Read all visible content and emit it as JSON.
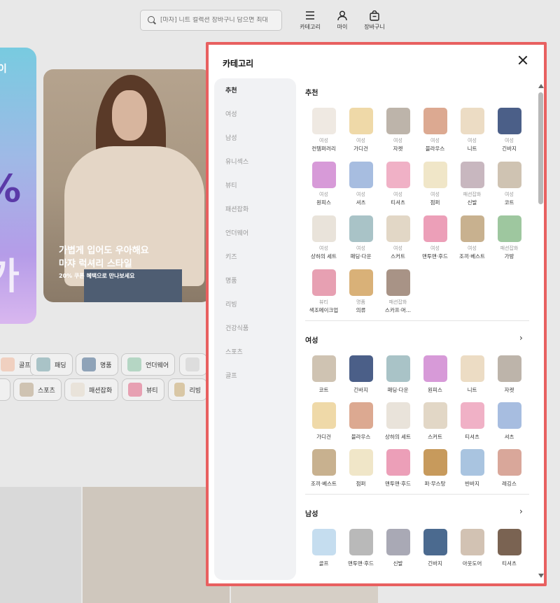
{
  "header": {
    "search_placeholder": "[마자] 니트 컬렉션 장바구니 담으면 최대",
    "nav": [
      {
        "label": "카테고리",
        "icon": "menu-icon"
      },
      {
        "label": "마이",
        "icon": "person-icon"
      },
      {
        "label": "장바구니",
        "icon": "bag-icon"
      }
    ]
  },
  "banner": {
    "left_text": "데이",
    "left_big": "%",
    "left_big2": "가",
    "main_line1": "가볍게 입어도 우아해요",
    "main_line2": "마쟈 럭셔리 스타일",
    "main_sub": "20% 쿠폰 혜택으로 만나보세요"
  },
  "chips": [
    "골프",
    "패딩",
    "명품",
    "언더웨어",
    "스포츠",
    "패션잡화",
    "뷰티",
    "리빙"
  ],
  "panel": {
    "title": "카테고리",
    "sidebar": [
      "추천",
      "여성",
      "남성",
      "유니섹스",
      "뷰티",
      "패션잡화",
      "언더웨어",
      "키즈",
      "명품",
      "리빙",
      "건강식품",
      "스포츠",
      "골프"
    ],
    "sections": [
      {
        "title": "추천",
        "items": [
          {
            "sub": "여성",
            "name": "컨템퍼러리",
            "color": "#efe9e2"
          },
          {
            "sub": "여성",
            "name": "가디건",
            "color": "#efd9a8"
          },
          {
            "sub": "여성",
            "name": "자켓",
            "color": "#bdb4aa"
          },
          {
            "sub": "여성",
            "name": "블라우스",
            "color": "#dca991"
          },
          {
            "sub": "여성",
            "name": "니트",
            "color": "#ecdcc4"
          },
          {
            "sub": "여성",
            "name": "긴바지",
            "color": "#4b5f88"
          },
          {
            "sub": "여성",
            "name": "원피스",
            "color": "#d79ad8"
          },
          {
            "sub": "여성",
            "name": "셔츠",
            "color": "#a7bde0"
          },
          {
            "sub": "여성",
            "name": "티셔츠",
            "color": "#f0b1c6"
          },
          {
            "sub": "여성",
            "name": "점퍼",
            "color": "#f0e6c8"
          },
          {
            "sub": "패션잡화",
            "name": "신발",
            "color": "#c8b7bf"
          },
          {
            "sub": "여성",
            "name": "코트",
            "color": "#cfc3b2"
          },
          {
            "sub": "여성",
            "name": "상하의 세트",
            "color": "#e9e3da"
          },
          {
            "sub": "여성",
            "name": "패딩·다운",
            "color": "#a9c3c7"
          },
          {
            "sub": "여성",
            "name": "스커트",
            "color": "#e2d7c6"
          },
          {
            "sub": "여성",
            "name": "맨투맨·후드",
            "color": "#ec9fb8"
          },
          {
            "sub": "여성",
            "name": "조끼·베스트",
            "color": "#c8b18f"
          },
          {
            "sub": "패션잡화",
            "name": "가방",
            "color": "#9ec79f"
          },
          {
            "sub": "뷰티",
            "name": "색조메이크업",
            "color": "#e7a0b2"
          },
          {
            "sub": "명품",
            "name": "의류",
            "color": "#d9b178"
          },
          {
            "sub": "패션잡화",
            "name": "스카프·머...",
            "color": "#a89386"
          }
        ]
      },
      {
        "title": "여성",
        "items": [
          {
            "name": "코트",
            "color": "#cfc3b2"
          },
          {
            "name": "긴바지",
            "color": "#4b5f88"
          },
          {
            "name": "패딩·다운",
            "color": "#a9c3c7"
          },
          {
            "name": "원피스",
            "color": "#d79ad8"
          },
          {
            "name": "니트",
            "color": "#ecdcc4"
          },
          {
            "name": "자켓",
            "color": "#bdb4aa"
          },
          {
            "name": "가디건",
            "color": "#efd9a8"
          },
          {
            "name": "블라우스",
            "color": "#dca991"
          },
          {
            "name": "상하의 세트",
            "color": "#e9e3da"
          },
          {
            "name": "스커트",
            "color": "#e2d7c6"
          },
          {
            "name": "티셔츠",
            "color": "#f0b1c6"
          },
          {
            "name": "셔츠",
            "color": "#a7bde0"
          },
          {
            "name": "조끼·베스트",
            "color": "#c8b18f"
          },
          {
            "name": "점퍼",
            "color": "#f0e6c8"
          },
          {
            "name": "맨투맨·후드",
            "color": "#ec9fb8"
          },
          {
            "name": "퍼·무스탕",
            "color": "#c79a5c"
          },
          {
            "name": "반바지",
            "color": "#a9c4e0"
          },
          {
            "name": "레깅스",
            "color": "#d9a79a"
          }
        ]
      },
      {
        "title": "남성",
        "items": [
          {
            "name": "골프",
            "color": "#c5ddef"
          },
          {
            "name": "맨투맨·후드",
            "color": "#b9b9b9"
          },
          {
            "name": "신발",
            "color": "#a9a9b5"
          },
          {
            "name": "긴바지",
            "color": "#4b6a8f"
          },
          {
            "name": "아웃도어",
            "color": "#d2c2b3"
          },
          {
            "name": "티셔츠",
            "color": "#7a6352"
          }
        ]
      }
    ]
  }
}
